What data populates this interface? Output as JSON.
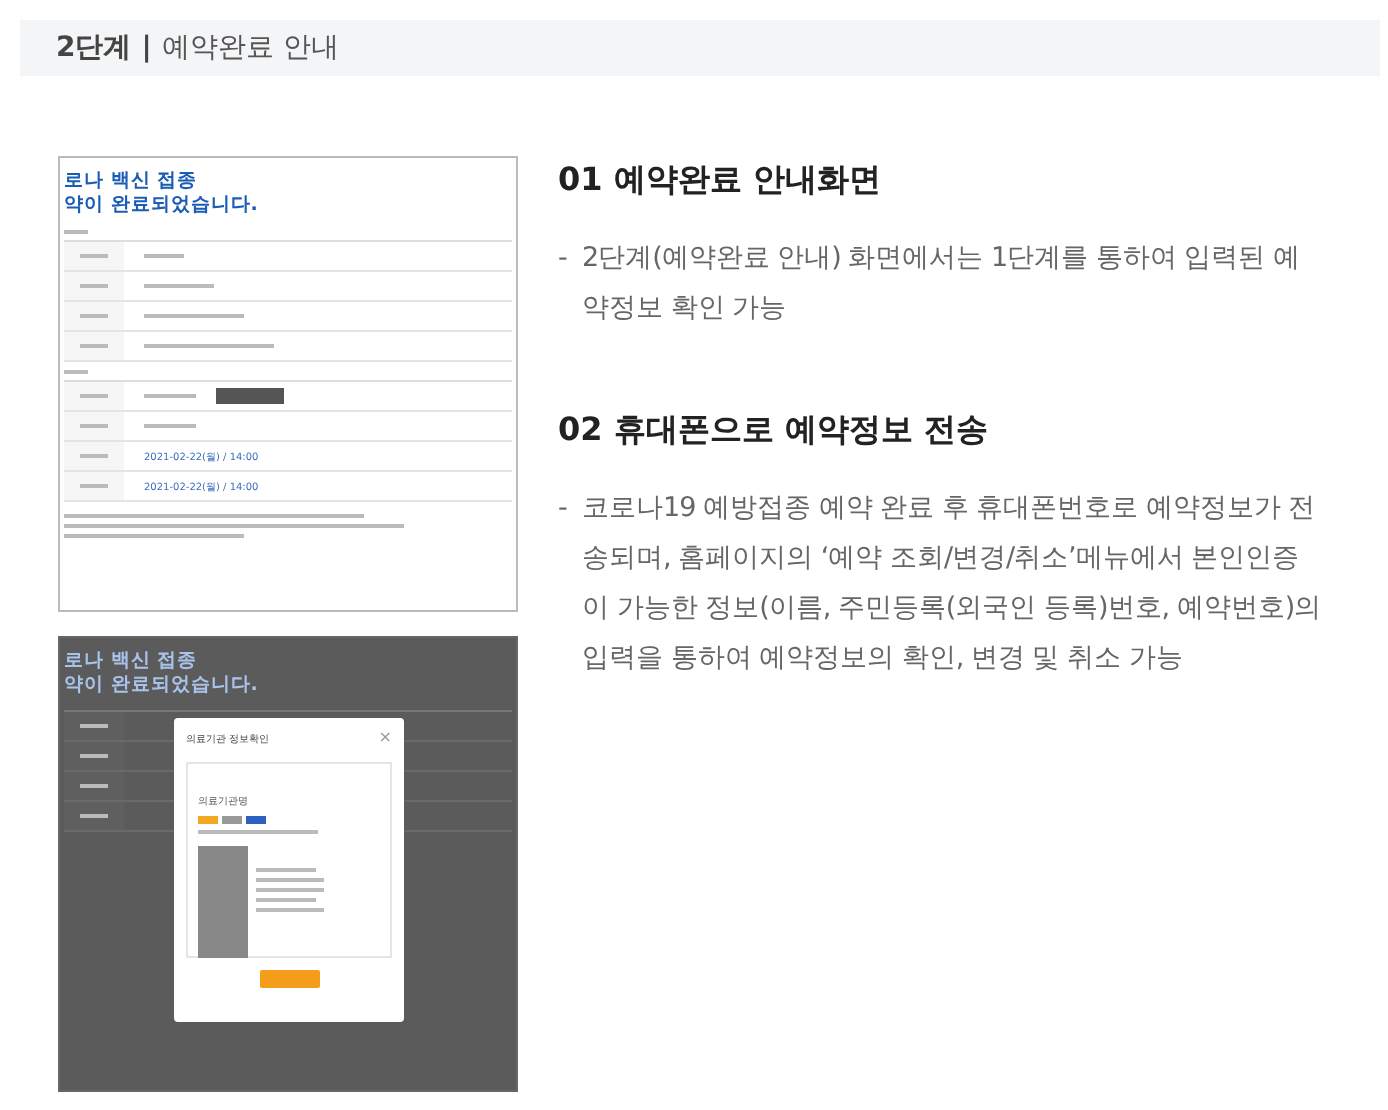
{
  "header": {
    "step": "2단계",
    "separator": "|",
    "title": "예약완료 안내"
  },
  "screens": [
    {
      "kind": "result",
      "headline": [
        "로나 백신 접종",
        "약이 완료되었습니다."
      ],
      "dates": [
        "2021-02-22(월) / 14:00",
        "2021-02-22(월) / 14:00"
      ]
    },
    {
      "kind": "modal",
      "headline": [
        "로나 백신 접종",
        "약이 완료되었습니다."
      ],
      "modal": {
        "title": "의료기관 정보확인",
        "close": "×",
        "name": "의료기관명"
      }
    }
  ],
  "sections": [
    {
      "title": "01 예약완료 안내화면",
      "bullets": [
        {
          "marker": "-",
          "text": "2단계(예약완료 안내) 화면에서는 1단계를 통하여 입력된 예약정보 확인 가능"
        }
      ]
    },
    {
      "title": "02 휴대폰으로 예약정보 전송",
      "bullets": [
        {
          "marker": "-",
          "text": "코로나19 예방접종 예약 완료 후 휴대폰번호로 예약정보가 전송되며, 홈페이지의 ‘예약 조회/변경/취소’메뉴에서 본인인증이 가능한 정보(이름, 주민등록(외국인 등록)번호, 예약번호)의 입력을 통하여 예약정보의 확인, 변경 및 취소 가능"
        }
      ]
    }
  ]
}
